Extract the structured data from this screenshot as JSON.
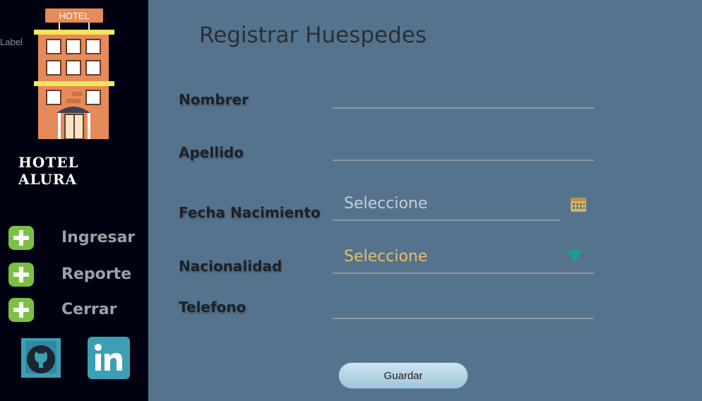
{
  "sidebar": {
    "stray_label": "Label",
    "logo_sign": "HOTEL",
    "brand": "HOTEL ALURA",
    "nav": [
      {
        "label": "Ingresar",
        "icon": "plus-icon"
      },
      {
        "label": "Reporte",
        "icon": "plus-icon"
      },
      {
        "label": "Cerrar",
        "icon": "plus-icon"
      }
    ],
    "social": [
      {
        "icon": "github-icon"
      },
      {
        "icon": "linkedin-icon"
      }
    ]
  },
  "form": {
    "title": "Registrar Huespedes",
    "fields": {
      "nombre": {
        "label": "Nombrer",
        "value": ""
      },
      "apellido": {
        "label": "Apellido",
        "value": ""
      },
      "fecha": {
        "label": "Fecha Nacimiento",
        "value": "Seleccione",
        "icon": "calendar-icon"
      },
      "nacionalidad": {
        "label": "Nacionalidad",
        "value": "Seleccione",
        "icon": "triangle-down-icon"
      },
      "telefono": {
        "label": "Telefono",
        "value": ""
      }
    },
    "save_label": "Guardar"
  },
  "colors": {
    "sidebar_bg": "#000211",
    "main_bg": "#55738d",
    "nav_icon": "#7bc043",
    "select_text": "#e8be62",
    "dropdown_arrow": "#1e9e88",
    "social_bg": "#3d9fb5"
  }
}
